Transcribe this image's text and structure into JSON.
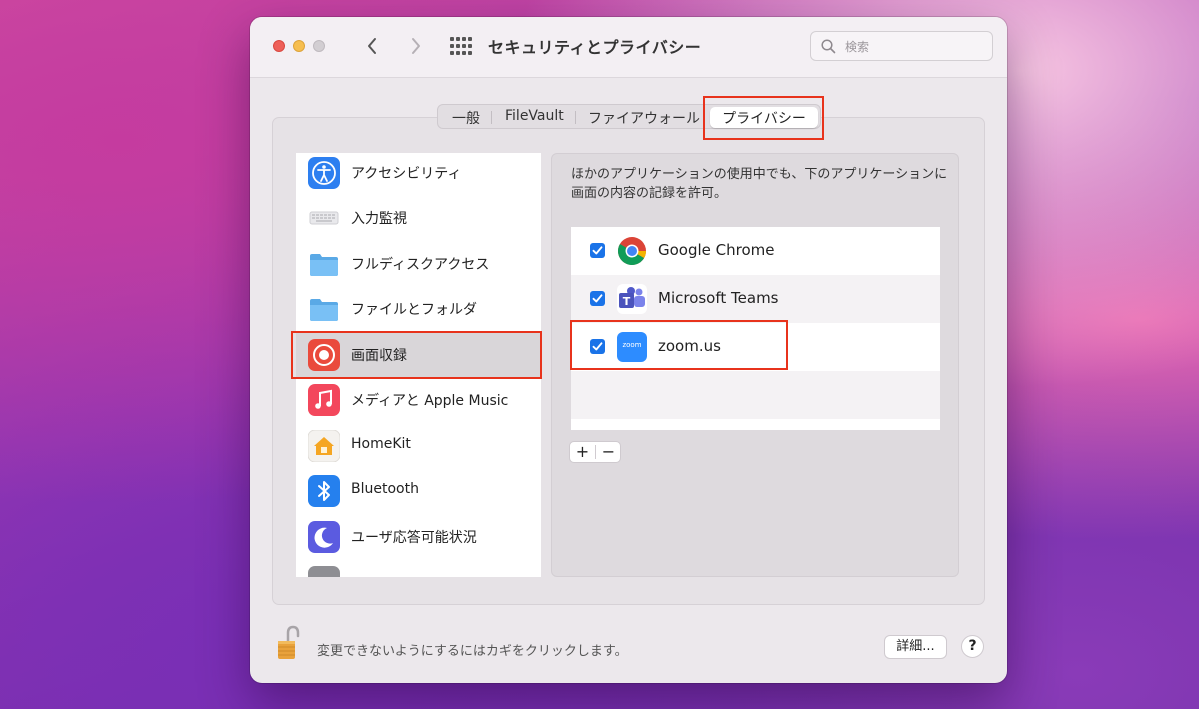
{
  "window": {
    "title": "セキュリティとプライバシー",
    "search_placeholder": "検索"
  },
  "tabs": [
    {
      "label": "一般",
      "active": false
    },
    {
      "label": "FileVault",
      "active": false
    },
    {
      "label": "ファイアウォール",
      "active": false
    },
    {
      "label": "プライバシー",
      "active": true
    }
  ],
  "sidebar": {
    "items": [
      {
        "label": "アクセシビリティ",
        "icon": "accessibility-icon"
      },
      {
        "label": "入力監視",
        "icon": "keyboard-icon"
      },
      {
        "label": "フルディスクアクセス",
        "icon": "folder-icon"
      },
      {
        "label": "ファイルとフォルダ",
        "icon": "folder-icon"
      },
      {
        "label": "画面収録",
        "icon": "screen-recording-icon",
        "selected": true
      },
      {
        "label": "メディアと Apple Music",
        "icon": "music-icon"
      },
      {
        "label": "HomeKit",
        "icon": "home-icon"
      },
      {
        "label": "Bluetooth",
        "icon": "bluetooth-icon"
      },
      {
        "label": "ユーザ応答可能状況",
        "icon": "moon-icon"
      }
    ]
  },
  "main": {
    "description": "ほかのアプリケーションの使用中でも、下のアプリケーションに画面の内容の記録を許可。",
    "apps": [
      {
        "name": "Google Chrome",
        "checked": true,
        "icon": "chrome-icon"
      },
      {
        "name": "Microsoft Teams",
        "checked": true,
        "icon": "teams-icon"
      },
      {
        "name": "zoom.us",
        "checked": true,
        "icon": "zoom-icon",
        "icon_text": "zoom"
      }
    ],
    "add_label": "+",
    "remove_label": "−"
  },
  "footer": {
    "lock_text": "変更できないようにするにはカギをクリックします。",
    "details_label": "詳細...",
    "help_label": "?"
  },
  "colors": {
    "highlight": "#e8331c",
    "checkbox": "#1a73e8"
  }
}
